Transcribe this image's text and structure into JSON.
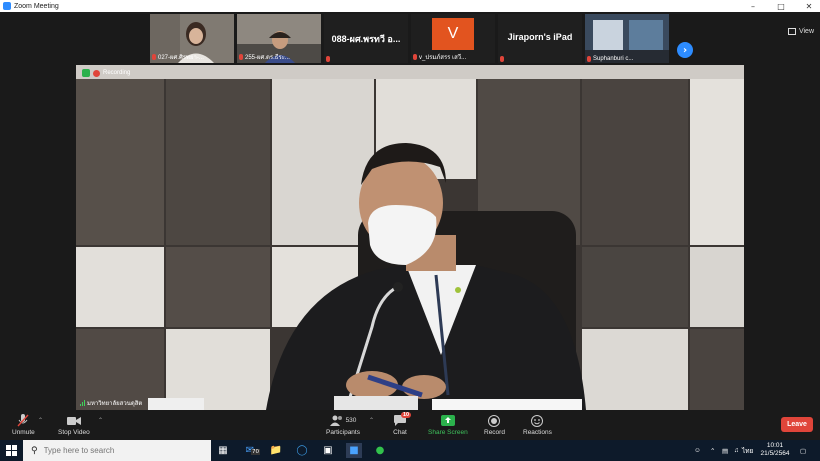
{
  "window": {
    "title": "Zoom Meeting"
  },
  "gallery": {
    "participants": [
      {
        "label": "027-ผศ.ศิรพยา-..."
      },
      {
        "label": "255-ผศ.ดร.ธีระ..."
      },
      {
        "label": "",
        "name": "088-ผศ.พรทวี อ..."
      },
      {
        "label": "v_ปรมภ์สรร เสวี...",
        "initial": "V"
      },
      {
        "label": "",
        "name": "Jiraporn's iPad"
      },
      {
        "label": "Suphanburi c..."
      }
    ],
    "view_label": "View"
  },
  "video": {
    "recording_label": "Recording",
    "room_name": "มหาวิทยาลัยสวนดุสิต"
  },
  "controls": {
    "unmute": "Unmute",
    "stop_video": "Stop Video",
    "participants": "Participants",
    "participants_count": "530",
    "chat": "Chat",
    "chat_badge": "10",
    "share_screen": "Share Screen",
    "record": "Record",
    "reactions": "Reactions",
    "leave": "Leave"
  },
  "taskbar": {
    "search_placeholder": "Type here to search",
    "mail_badge": "70",
    "lang": "ไทย",
    "time": "10:01",
    "date": "21/5/2564"
  },
  "colors": {
    "accent_blue": "#2d8cff",
    "leave_red": "#e0453a",
    "share_green": "#2bb14c",
    "orange_avatar": "#e2541f"
  }
}
